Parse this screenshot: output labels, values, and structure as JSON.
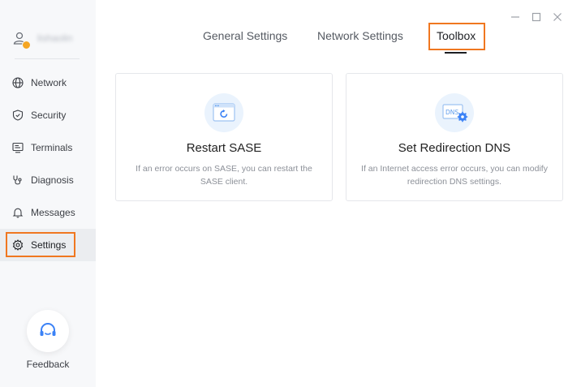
{
  "user": {
    "name": "lishaolin"
  },
  "sidebar": {
    "items": [
      {
        "label": "Network",
        "icon": "globe-icon"
      },
      {
        "label": "Security",
        "icon": "shield-icon"
      },
      {
        "label": "Terminals",
        "icon": "terminal-icon"
      },
      {
        "label": "Diagnosis",
        "icon": "stethoscope-icon"
      },
      {
        "label": "Messages",
        "icon": "bell-icon"
      },
      {
        "label": "Settings",
        "icon": "gear-icon",
        "active": true
      }
    ],
    "feedback_label": "Feedback"
  },
  "tabs": [
    {
      "label": "General Settings"
    },
    {
      "label": "Network Settings"
    },
    {
      "label": "Toolbox",
      "active": true
    }
  ],
  "cards": [
    {
      "title": "Restart SASE",
      "description": "If an error occurs on SASE, you can restart the SASE client.",
      "icon": "restart-window-icon"
    },
    {
      "title": "Set Redirection DNS",
      "description": "If an Internet access error occurs, you can modify redirection DNS settings.",
      "icon": "dns-settings-icon",
      "icon_text": "DNS"
    }
  ],
  "colors": {
    "highlight": "#f07720",
    "accent_blue": "#3b82f6",
    "badge": "#f5a623"
  }
}
